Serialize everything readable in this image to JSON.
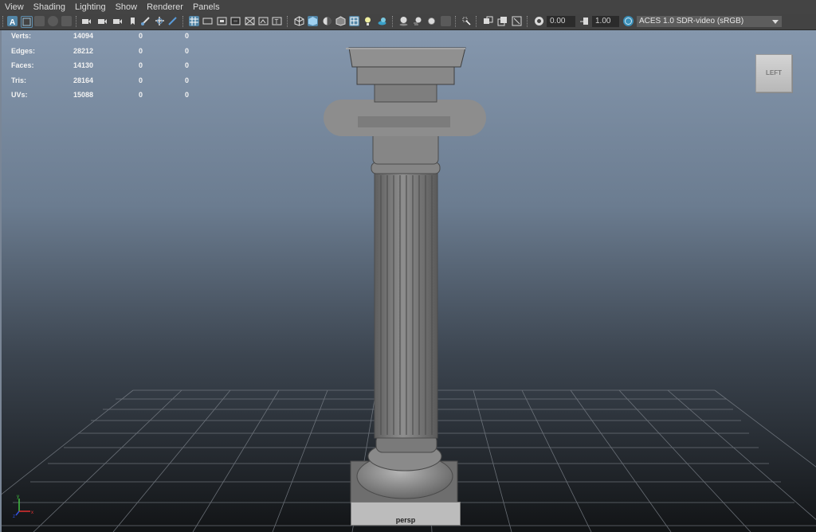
{
  "menu": [
    "View",
    "Shading",
    "Lighting",
    "Show",
    "Renderer",
    "Panels"
  ],
  "toolbar": {
    "exposure": "0.00",
    "gamma": "1.00",
    "color_space": "ACES 1.0 SDR-video (sRGB)"
  },
  "hud": {
    "rows": [
      {
        "label": "Verts:",
        "values": [
          "14094",
          "0",
          "0"
        ]
      },
      {
        "label": "Edges:",
        "values": [
          "28212",
          "0",
          "0"
        ]
      },
      {
        "label": "Faces:",
        "values": [
          "14130",
          "0",
          "0"
        ]
      },
      {
        "label": "Tris:",
        "values": [
          "28164",
          "0",
          "0"
        ]
      },
      {
        "label": "UVs:",
        "values": [
          "15088",
          "0",
          "0"
        ]
      }
    ]
  },
  "viewcube": {
    "label": "LEFT"
  },
  "camera": {
    "name": "persp"
  },
  "axis": {
    "y": "y",
    "x": "x",
    "z": "z"
  },
  "colors": {
    "highlight": "#5285a6",
    "axis_x": "#e03030",
    "axis_y": "#40c040",
    "axis_z": "#3050e0"
  }
}
